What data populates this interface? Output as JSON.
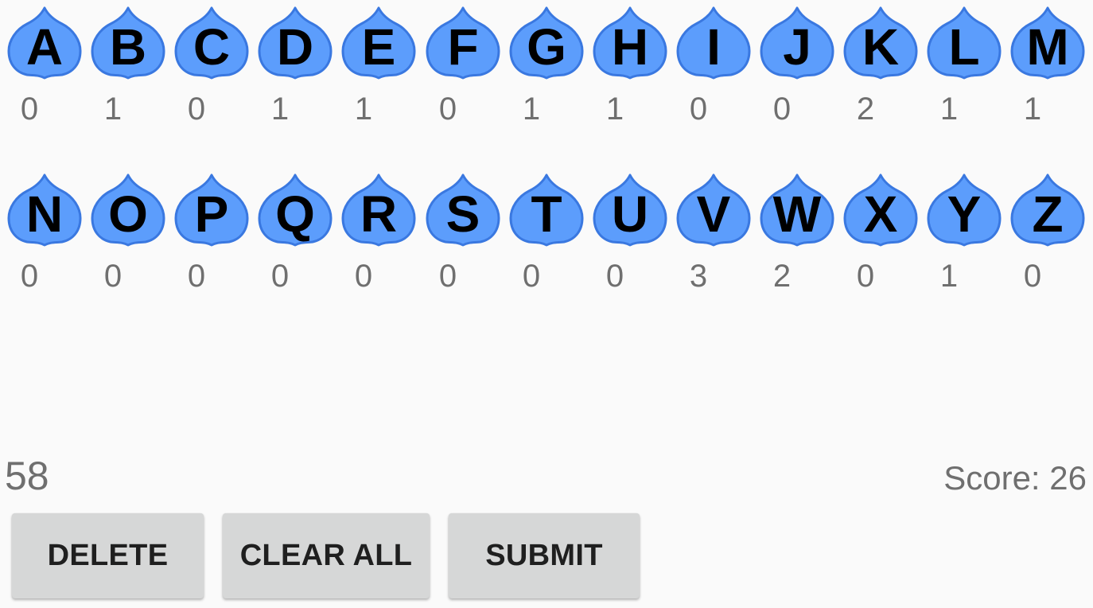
{
  "tile_color": "#5c9dfc",
  "tile_outline": "#3a78e0",
  "letter_rows": [
    [
      {
        "letter": "A",
        "count": "0"
      },
      {
        "letter": "B",
        "count": "1"
      },
      {
        "letter": "C",
        "count": "0"
      },
      {
        "letter": "D",
        "count": "1"
      },
      {
        "letter": "E",
        "count": "1"
      },
      {
        "letter": "F",
        "count": "0"
      },
      {
        "letter": "G",
        "count": "1"
      },
      {
        "letter": "H",
        "count": "1"
      },
      {
        "letter": "I",
        "count": "0"
      },
      {
        "letter": "J",
        "count": "0"
      },
      {
        "letter": "K",
        "count": "2"
      },
      {
        "letter": "L",
        "count": "1"
      },
      {
        "letter": "M",
        "count": "1"
      }
    ],
    [
      {
        "letter": "N",
        "count": "0"
      },
      {
        "letter": "O",
        "count": "0"
      },
      {
        "letter": "P",
        "count": "0"
      },
      {
        "letter": "Q",
        "count": "0"
      },
      {
        "letter": "R",
        "count": "0"
      },
      {
        "letter": "S",
        "count": "0"
      },
      {
        "letter": "T",
        "count": "0"
      },
      {
        "letter": "U",
        "count": "0"
      },
      {
        "letter": "V",
        "count": "3"
      },
      {
        "letter": "W",
        "count": "2"
      },
      {
        "letter": "X",
        "count": "0"
      },
      {
        "letter": "Y",
        "count": "1"
      },
      {
        "letter": "Z",
        "count": "0"
      }
    ]
  ],
  "timer": "58",
  "score": "Score: 26",
  "buttons": {
    "delete": "DELETE",
    "clear_all": "CLEAR ALL",
    "submit": "SUBMIT"
  }
}
